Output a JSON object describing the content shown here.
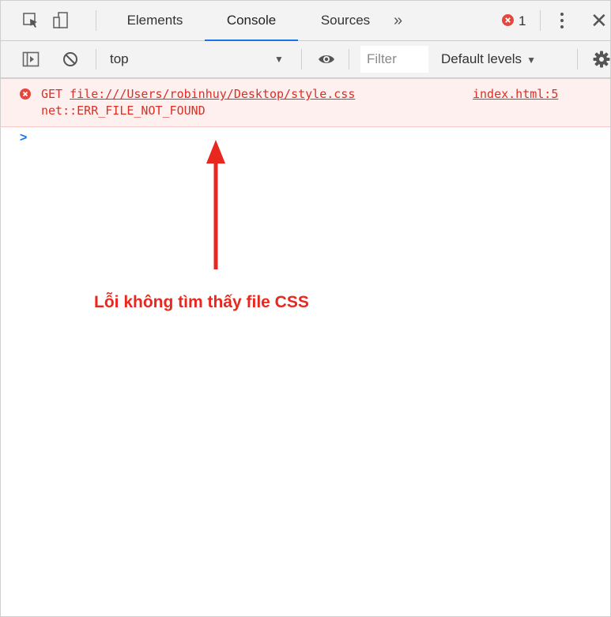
{
  "tabs": [
    {
      "label": "Elements"
    },
    {
      "label": "Console"
    },
    {
      "label": "Sources"
    }
  ],
  "tab_overflow": "»",
  "error_count": "1",
  "toolbar": {
    "context": "top",
    "filter_placeholder": "Filter",
    "levels_label": "Default levels"
  },
  "console": {
    "error": {
      "method": "GET",
      "url": "file:///Users/robinhuy/Desktop/style.css",
      "detail": "net::ERR_FILE_NOT_FOUND",
      "source": "index.html:5"
    },
    "prompt_symbol": ">"
  },
  "annotation": {
    "text": "Lỗi không tìm thấy file CSS",
    "color": "#e8281e"
  },
  "colors": {
    "error_text": "#d93025",
    "error_bg": "#fff0f0",
    "accent": "#1a73e8"
  }
}
